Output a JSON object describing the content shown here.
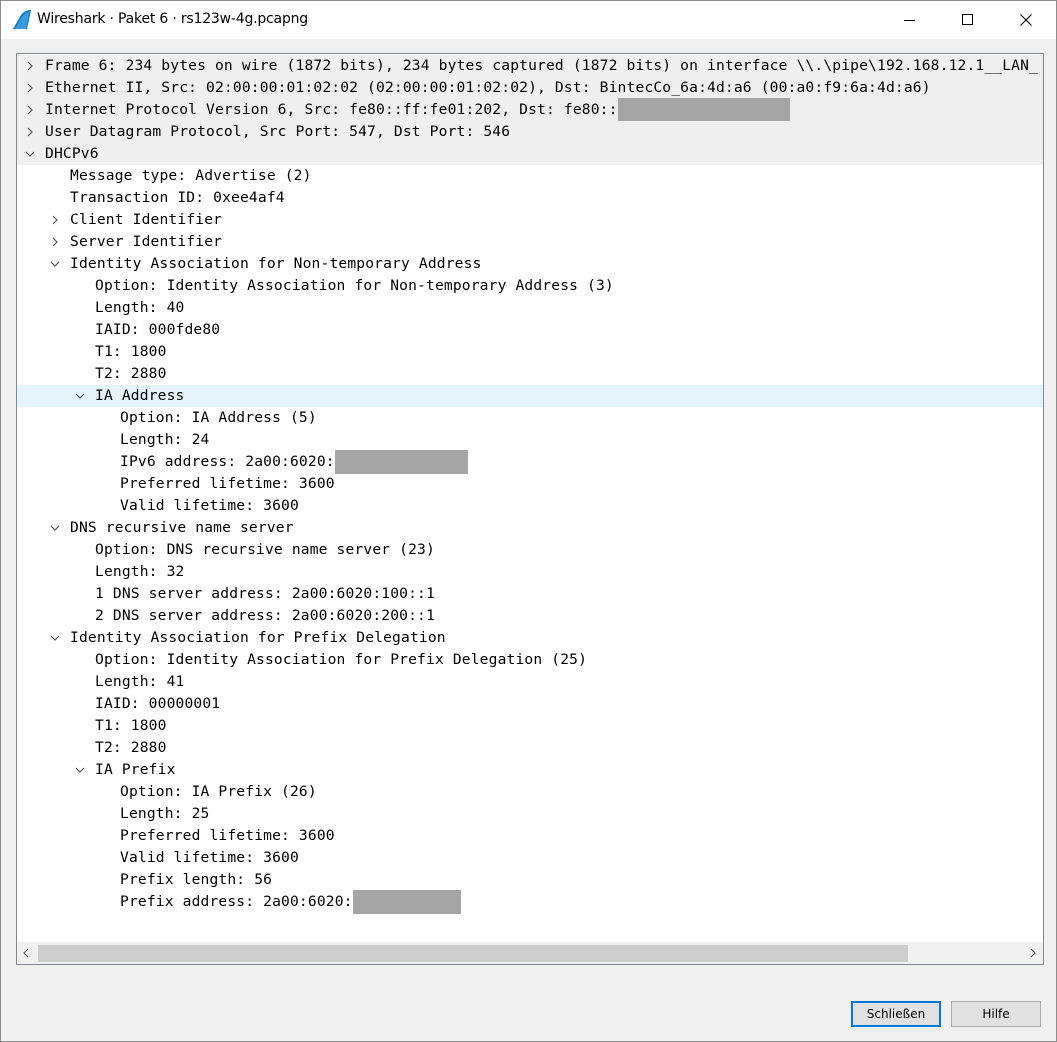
{
  "window": {
    "title": "Wireshark · Paket 6 · rs123w-4g.pcapng"
  },
  "tree": {
    "rows": [
      {
        "text": "Frame 6: 234 bytes on wire (1872 bits), 234 bytes captured (1872 bits) on interface \\\\.\\pipe\\192.168.12.1__LAN_",
        "expander": "collapsed"
      },
      {
        "text": "Ethernet II, Src: 02:00:00:01:02:02 (02:00:00:01:02:02), Dst: BintecCo_6a:4d:a6 (00:a0:f9:6a:4d:a6)",
        "expander": "collapsed"
      },
      {
        "text": "Internet Protocol Version 6, Src: fe80::ff:fe01:202, Dst: fe80::",
        "expander": "collapsed"
      },
      {
        "text": "User Datagram Protocol, Src Port: 547, Dst Port: 546",
        "expander": "collapsed"
      },
      {
        "text": "DHCPv6",
        "expander": "expanded"
      },
      {
        "text": "Message type: Advertise (2)",
        "expander": "none"
      },
      {
        "text": "Transaction ID: 0xee4af4",
        "expander": "none"
      },
      {
        "text": "Client Identifier",
        "expander": "collapsed"
      },
      {
        "text": "Server Identifier",
        "expander": "collapsed"
      },
      {
        "text": "Identity Association for Non-temporary Address",
        "expander": "expanded"
      },
      {
        "text": "Option: Identity Association for Non-temporary Address (3)",
        "expander": "none"
      },
      {
        "text": "Length: 40",
        "expander": "none"
      },
      {
        "text": "IAID: 000fde80",
        "expander": "none"
      },
      {
        "text": "T1: 1800",
        "expander": "none"
      },
      {
        "text": "T2: 2880",
        "expander": "none"
      },
      {
        "text": "IA Address",
        "expander": "expanded"
      },
      {
        "text": "Option: IA Address (5)",
        "expander": "none"
      },
      {
        "text": "Length: 24",
        "expander": "none"
      },
      {
        "text": "IPv6 address: 2a00:6020:",
        "expander": "none"
      },
      {
        "text": "Preferred lifetime: 3600",
        "expander": "none"
      },
      {
        "text": "Valid lifetime: 3600",
        "expander": "none"
      },
      {
        "text": "DNS recursive name server",
        "expander": "expanded"
      },
      {
        "text": "Option: DNS recursive name server (23)",
        "expander": "none"
      },
      {
        "text": "Length: 32",
        "expander": "none"
      },
      {
        "text": " 1 DNS server address: 2a00:6020:100::1",
        "expander": "none"
      },
      {
        "text": " 2 DNS server address: 2a00:6020:200::1",
        "expander": "none"
      },
      {
        "text": "Identity Association for Prefix Delegation",
        "expander": "expanded"
      },
      {
        "text": "Option: Identity Association for Prefix Delegation (25)",
        "expander": "none"
      },
      {
        "text": "Length: 41",
        "expander": "none"
      },
      {
        "text": "IAID: 00000001",
        "expander": "none"
      },
      {
        "text": "T1: 1800",
        "expander": "none"
      },
      {
        "text": "T2: 2880",
        "expander": "none"
      },
      {
        "text": "IA Prefix",
        "expander": "expanded"
      },
      {
        "text": "Option: IA Prefix (26)",
        "expander": "none"
      },
      {
        "text": "Length: 25",
        "expander": "none"
      },
      {
        "text": "Preferred lifetime: 3600",
        "expander": "none"
      },
      {
        "text": "Valid lifetime: 3600",
        "expander": "none"
      },
      {
        "text": "Prefix length: 56",
        "expander": "none"
      },
      {
        "text": "Prefix address: 2a00:6020:",
        "expander": "none"
      }
    ]
  },
  "buttons": {
    "close_label": "Schließen",
    "help_label": "Hilfe"
  },
  "colors": {
    "section_bg": "#efefef",
    "selected_bg": "#e5f3fb",
    "redaction": "#a5a5a5"
  }
}
